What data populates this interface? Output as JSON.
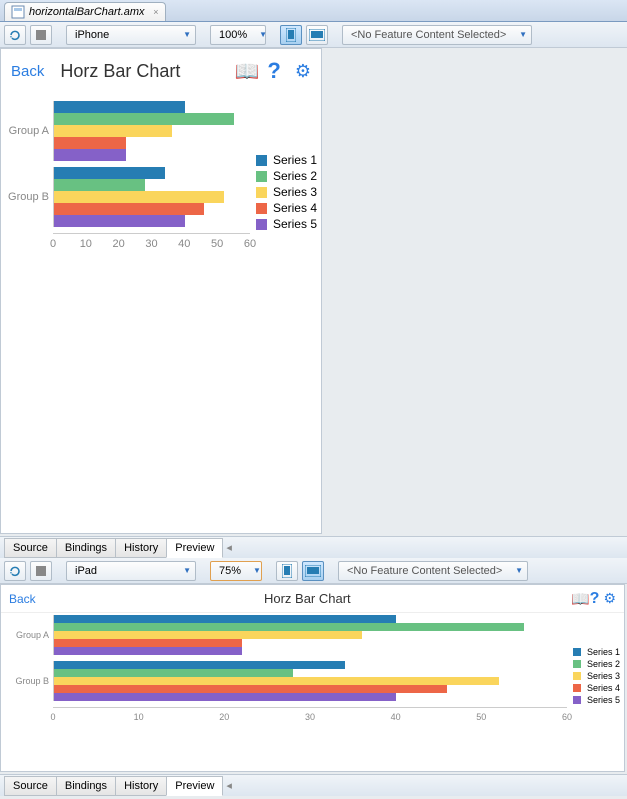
{
  "file_tab": {
    "name": "horizontalBarChart.amx"
  },
  "pane1": {
    "toolbar": {
      "device": "iPhone",
      "zoom": "100%",
      "feature_placeholder": "<No Feature Content Selected>"
    },
    "header": {
      "back": "Back",
      "title": "Horz Bar Chart"
    },
    "tabs": {
      "source": "Source",
      "bindings": "Bindings",
      "history": "History",
      "preview": "Preview"
    }
  },
  "pane2": {
    "toolbar": {
      "device": "iPad",
      "zoom": "75%",
      "feature_placeholder": "<No Feature Content Selected>"
    },
    "header": {
      "back": "Back",
      "title": "Horz Bar Chart"
    },
    "tabs": {
      "source": "Source",
      "bindings": "Bindings",
      "history": "History",
      "preview": "Preview"
    }
  },
  "legend": {
    "s1": "Series 1",
    "s2": "Series 2",
    "s3": "Series 3",
    "s4": "Series 4",
    "s5": "Series 5"
  },
  "groups": {
    "a": "Group A",
    "b": "Group B"
  },
  "axis_ticks": [
    "0",
    "10",
    "20",
    "30",
    "40",
    "50",
    "60"
  ],
  "colors": {
    "s1": "#267db3",
    "s2": "#68c182",
    "s3": "#fad55c",
    "s4": "#ed6647",
    "s5": "#8561c8"
  },
  "chart_data": {
    "type": "bar",
    "orientation": "horizontal",
    "title": "Horz Bar Chart",
    "categories": [
      "Group A",
      "Group B"
    ],
    "series": [
      {
        "name": "Series 1",
        "values": [
          40,
          34
        ],
        "color": "#267db3"
      },
      {
        "name": "Series 2",
        "values": [
          55,
          28
        ],
        "color": "#68c182"
      },
      {
        "name": "Series 3",
        "values": [
          36,
          52
        ],
        "color": "#fad55c"
      },
      {
        "name": "Series 4",
        "values": [
          22,
          46
        ],
        "color": "#ed6647"
      },
      {
        "name": "Series 5",
        "values": [
          22,
          40
        ],
        "color": "#8561c8"
      }
    ],
    "xlabel": "",
    "ylabel": "",
    "xlim": [
      0,
      60
    ],
    "ticks": [
      0,
      10,
      20,
      30,
      40,
      50,
      60
    ]
  }
}
